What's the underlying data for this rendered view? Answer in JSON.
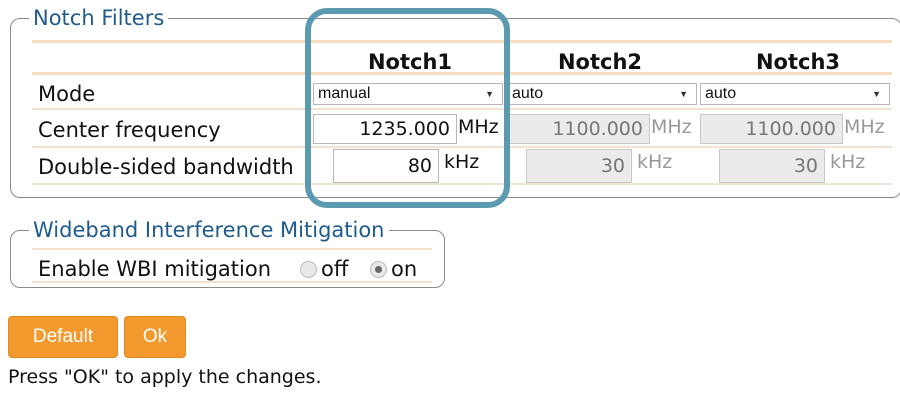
{
  "notch_filters": {
    "legend": "Notch Filters",
    "columns": [
      "Notch1",
      "Notch2",
      "Notch3"
    ],
    "mode": {
      "label": "Mode",
      "values": [
        "manual",
        "auto",
        "auto"
      ]
    },
    "center_frequency": {
      "label": "Center frequency",
      "values": [
        "1235.000",
        "1100.000",
        "1100.000"
      ],
      "unit": "MHz"
    },
    "bandwidth": {
      "label": "Double-sided bandwidth",
      "values": [
        "80",
        "30",
        "30"
      ],
      "unit": "kHz"
    }
  },
  "wbi": {
    "legend": "Wideband Interference Mitigation",
    "label": "Enable WBI mitigation",
    "options": [
      "off",
      "on"
    ],
    "selected": "on"
  },
  "buttons": {
    "default": "Default",
    "ok": "Ok"
  },
  "status": "Press \"OK\" to apply the changes.",
  "colors": {
    "accent": "#f29a2e",
    "highlight": "#5b9ab0",
    "legend": "#1f5b8c",
    "stripe": "#f7dcc0"
  }
}
